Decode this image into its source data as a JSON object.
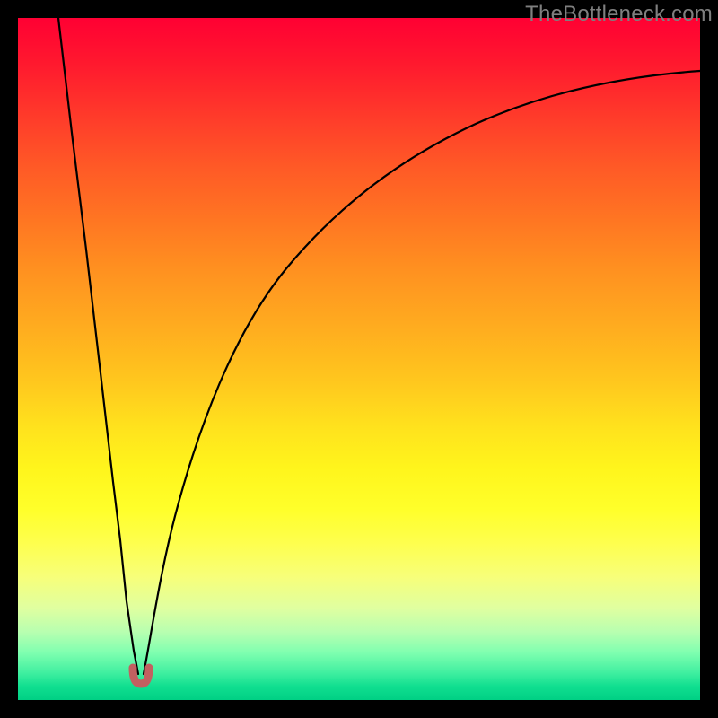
{
  "watermark": {
    "text": "TheBottleneck.com"
  },
  "chart_data": {
    "type": "line",
    "title": "",
    "xlabel": "",
    "ylabel": "",
    "xlim": [
      0,
      100
    ],
    "ylim": [
      0,
      100
    ],
    "grid": false,
    "legend": false,
    "notes": "Bottleneck curve: two black branches forming a V shape with a rounded minimum marked by a small red dot at the dip. Background is a vertical gradient from red (top, high bottleneck) through orange and yellow to green (bottom, low bottleneck).",
    "optimum": {
      "x": 18,
      "y": 3
    },
    "marker": {
      "color": "#c26060",
      "shape": "rounded-u",
      "position_x": 18,
      "position_y": 3
    },
    "background_gradient_stops": [
      {
        "pct": 0,
        "color": "#ff0033"
      },
      {
        "pct": 25,
        "color": "#ff6a24"
      },
      {
        "pct": 50,
        "color": "#ffc41e"
      },
      {
        "pct": 72,
        "color": "#ffff2a"
      },
      {
        "pct": 90,
        "color": "#b8ffb0"
      },
      {
        "pct": 100,
        "color": "#00d084"
      }
    ],
    "series": [
      {
        "name": "left-branch",
        "x": [
          6,
          8,
          10,
          12,
          14,
          15,
          16,
          17,
          17.6
        ],
        "y": [
          100,
          83,
          66,
          49,
          32,
          23,
          14,
          7,
          3.5
        ]
      },
      {
        "name": "right-branch",
        "x": [
          18.4,
          19,
          20,
          22,
          25,
          30,
          36,
          43,
          52,
          62,
          74,
          87,
          100
        ],
        "y": [
          3.5,
          7,
          14,
          26,
          39,
          53,
          63,
          71,
          78,
          83,
          87,
          90,
          92
        ]
      }
    ]
  }
}
